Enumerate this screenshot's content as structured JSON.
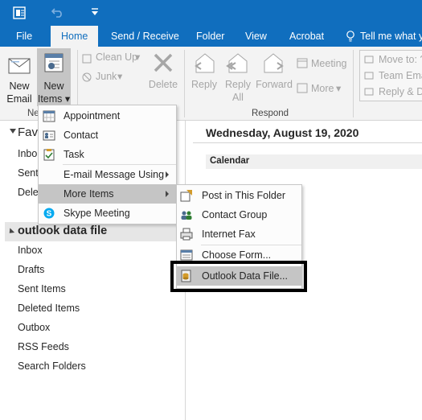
{
  "quick_access": {
    "icons": [
      "outlook-icon",
      "undo-icon",
      "customize-icon"
    ]
  },
  "tabs": [
    "File",
    "Home",
    "Send / Receive",
    "Folder",
    "View",
    "Acrobat"
  ],
  "tell_me": "Tell me what y",
  "ribbon": {
    "new_email": [
      "New",
      "Email"
    ],
    "new_items": [
      "New",
      "Items ▾"
    ],
    "group_new": "Ne",
    "clean_up": "Clean Up",
    "junk": "Junk",
    "delete": "Delete",
    "reply": "Reply",
    "reply_all": [
      "Reply",
      "All"
    ],
    "forward": "Forward",
    "meeting": "Meeting",
    "more": "More",
    "group_respond": "Respond",
    "move_to": "Move to: ?",
    "team_email": "Team Ema",
    "reply_delete": "Reply & D"
  },
  "nav": {
    "favorites_header": "Favo",
    "favorites": [
      "Inbo",
      "Sent",
      "Dele"
    ],
    "account_header": "outlook data file",
    "folders": [
      "Inbox",
      "Drafts",
      "Sent Items",
      "Deleted Items",
      "Outbox",
      "RSS Feeds",
      "Search Folders"
    ]
  },
  "main": {
    "date": "Wednesday, August 19, 2020",
    "section": "Calendar"
  },
  "new_items_menu": [
    {
      "label": "Appointment",
      "icon": "calendar-icon"
    },
    {
      "label": "Contact",
      "icon": "contact-card-icon"
    },
    {
      "label": "Task",
      "icon": "task-clipboard-icon"
    },
    {
      "label": "E-mail Message Using",
      "icon": ""
    },
    {
      "label": "More Items",
      "icon": ""
    },
    {
      "label": "Skype Meeting",
      "icon": "skype-icon"
    }
  ],
  "more_items_menu": [
    {
      "label": "Post in This Folder",
      "icon": "post-icon"
    },
    {
      "label": "Contact Group",
      "icon": "contact-group-icon"
    },
    {
      "label": "Internet Fax",
      "icon": "fax-icon"
    },
    {
      "label": "Choose Form...",
      "icon": "form-icon"
    },
    {
      "label": "Outlook Data File...",
      "icon": "data-file-icon"
    }
  ],
  "colors": {
    "brand": "#106ebe",
    "highlight": "#c5c5c5",
    "ribbon": "#f3f3f3"
  }
}
